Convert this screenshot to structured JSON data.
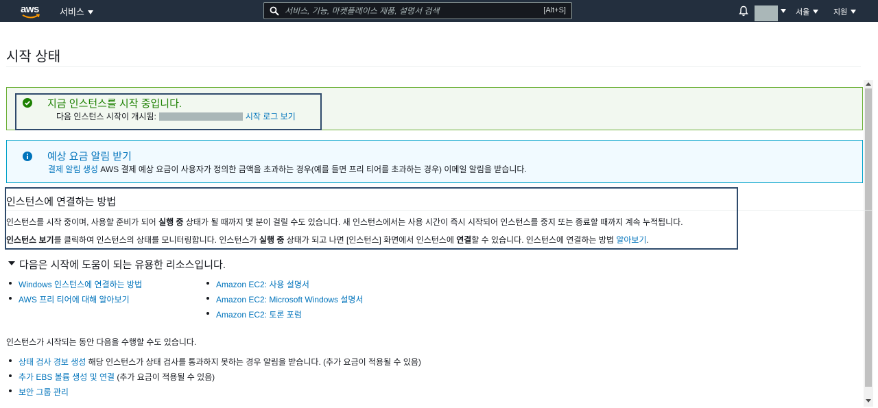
{
  "nav": {
    "logo_text": "aws",
    "services_label": "서비스",
    "search_placeholder": "서비스, 기능, 마켓플레이스 제품, 설명서 검색",
    "search_shortcut": "[Alt+S]",
    "region_label": "서울",
    "support_label": "지원"
  },
  "page": {
    "title": "시작 상태"
  },
  "success_alert": {
    "title": "지금 인스턴스를 시작 중입니다.",
    "line_prefix": "다음 인스턴스 시작이 개시됨:",
    "log_link": "시작 로그 보기"
  },
  "info_alert": {
    "title": "예상 요금 알림 받기",
    "link": "결제 알림 생성",
    "text": " AWS 결제 예상 요금이 사용자가 정의한 금액을 초과하는 경우(예를 들면 프리 티어를 초과하는 경우) 이메일 알림을 받습니다."
  },
  "connect": {
    "title": "인스턴스에 연결하는 방법",
    "line1_a": "인스턴스를 시작 중이며, 사용할 준비가 되어 ",
    "line1_b": "실행 중",
    "line1_c": " 상태가 될 때까지 몇 분이 걸릴 수도 있습니다. 새 인스턴스에서는 사용 시간이 즉시 시작되어 인스턴스를 중지 또는 종료할 때까지 계속 누적됩니다.",
    "line2_a": "인스턴스 보기",
    "line2_b": "를 클릭하여 인스턴스의 상태를 모니터링합니다. 인스턴스가 ",
    "line2_c": "실행 중",
    "line2_d": " 상태가 되고 나면 [인스턴스] 화면에서 인스턴스에 ",
    "line2_e": "연결",
    "line2_f": "할 수 있습니다. 인스턴스에 연결하는 방법 ",
    "line2_link": "알아보기",
    "line2_end": "."
  },
  "resources": {
    "title": "다음은 시작에 도움이 되는 유용한 리소스입니다.",
    "col1": [
      "Windows 인스턴스에 연결하는 방법",
      "AWS 프리 티어에 대해 알아보기"
    ],
    "col2": [
      "Amazon EC2: 사용 설명서",
      "Amazon EC2: Microsoft Windows 설명서",
      "Amazon EC2: 토론 포럼"
    ]
  },
  "todo": {
    "intro": "인스턴스가 시작되는 동안 다음을 수행할 수도 있습니다.",
    "items": [
      {
        "link": "상태 검사 경보 생성",
        "text": " 해당 인스턴스가 상태 검사를 통과하지 못하는 경우 알림을 받습니다. (추가 요금이 적용될 수 있음)"
      },
      {
        "link": "추가 EBS 볼륨 생성 및 연결",
        "text": " (추가 요금이 적용될 수 있음)"
      },
      {
        "link": "보안 그룹 관리",
        "text": ""
      }
    ]
  },
  "icons": {
    "success": "check-circle-icon",
    "info": "info-circle-icon",
    "search": "search-icon",
    "bell": "bell-icon"
  },
  "colors": {
    "nav_bg": "#232f3e",
    "success": "#1d8102",
    "link": "#0073bb"
  }
}
